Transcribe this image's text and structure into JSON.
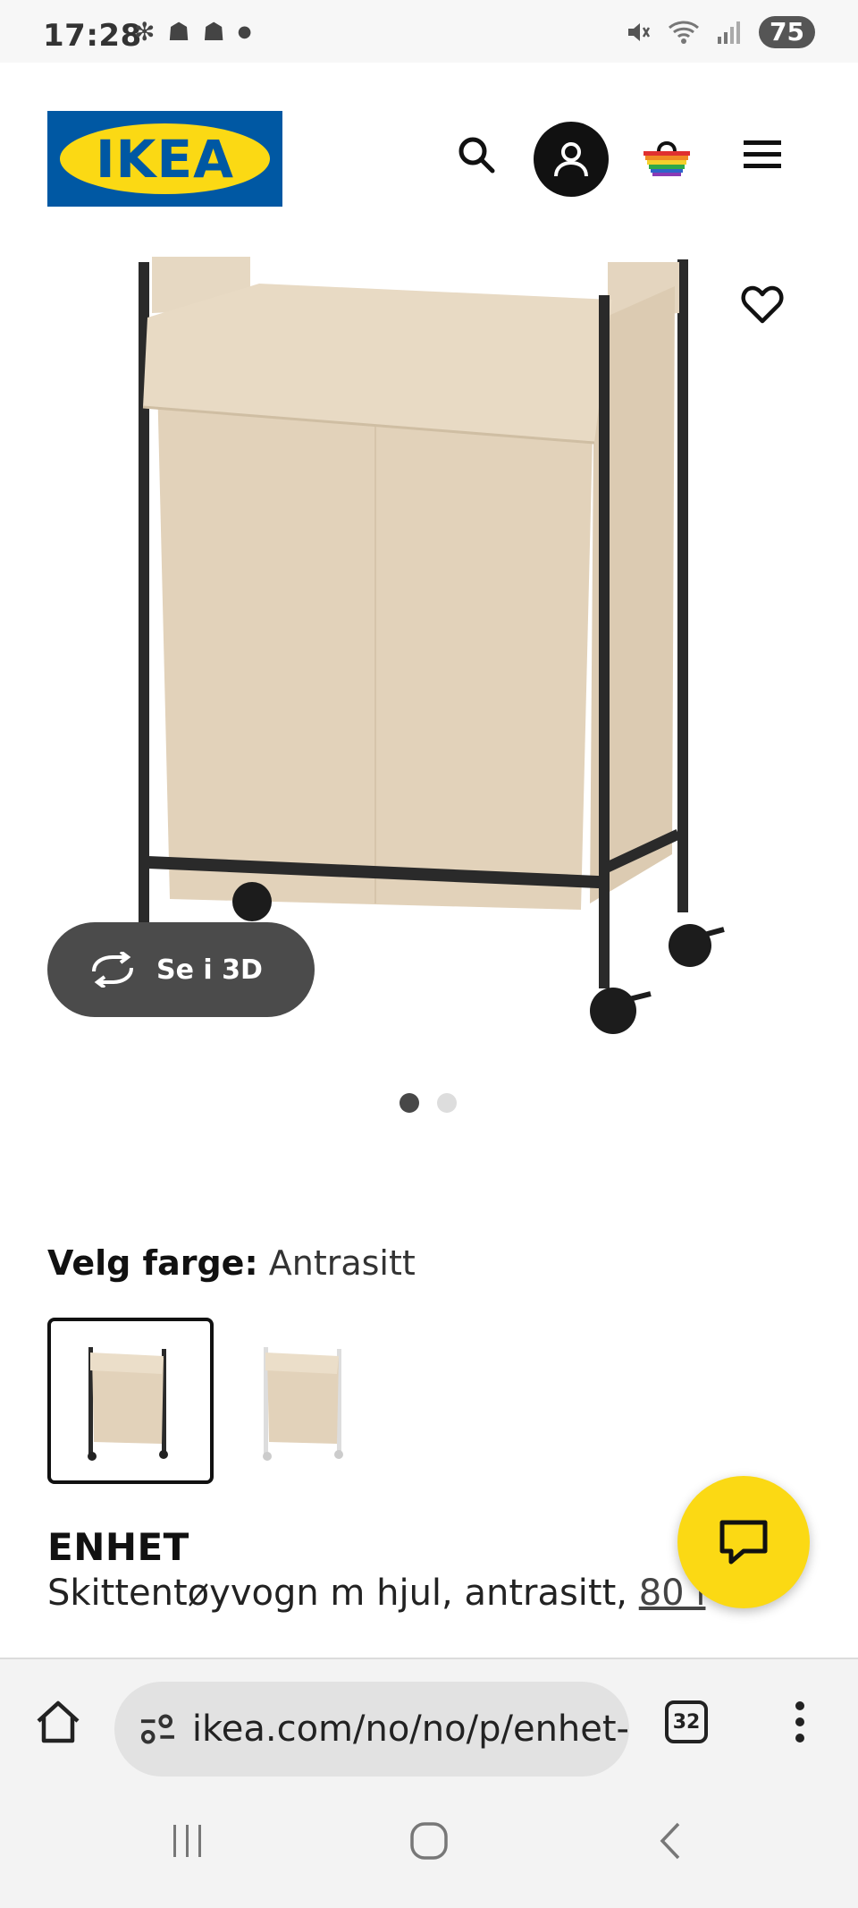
{
  "status_bar": {
    "time": "17:28",
    "battery": "75"
  },
  "header": {
    "logo_text": "IKEA",
    "brand_colors": {
      "blue": "#0058a3",
      "yellow": "#fbd914"
    },
    "icons": [
      "search-icon",
      "account-icon",
      "basket-icon",
      "menu-icon"
    ]
  },
  "product": {
    "view_3d_label": "Se i 3D",
    "gallery_dots": 2,
    "gallery_active": 1,
    "color_prefix": "Velg farge:",
    "color_value": "Antrasitt",
    "name": "ENHET",
    "description": "Skittentøyvogn m hjul, antrasitt,",
    "size": "80 l"
  },
  "browser": {
    "url": "ikea.com/no/no/p/enhet-",
    "tab_count": "32"
  }
}
